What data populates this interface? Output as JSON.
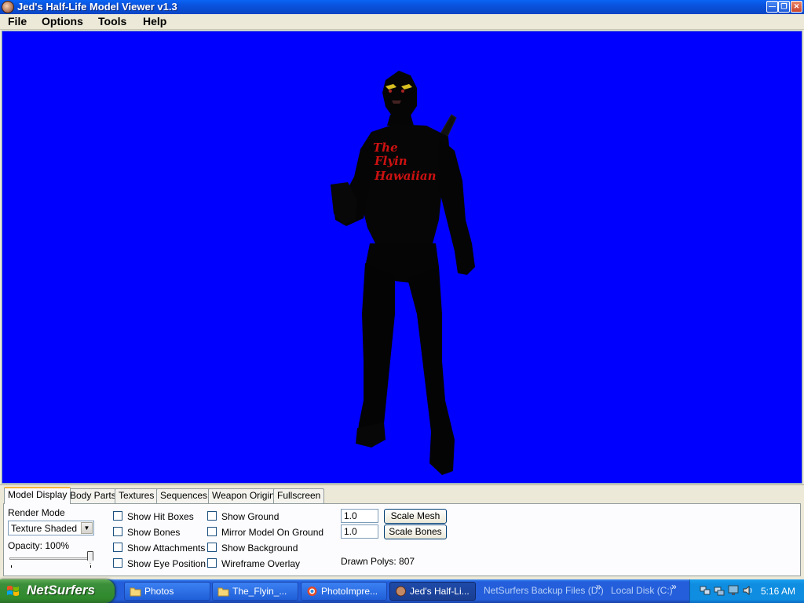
{
  "window": {
    "title": "Jed's Half-Life Model Viewer v1.3",
    "icon": "app-face-icon"
  },
  "menu": [
    "File",
    "Options",
    "Tools",
    "Help"
  ],
  "viewport": {
    "background": "#0000ff",
    "model_text": [
      "The",
      "Flyin",
      "Hawaiian"
    ],
    "model_text_color": "#cc1111"
  },
  "tabs": [
    "Model Display",
    "Body Parts",
    "Textures",
    "Sequences",
    "Weapon Origin",
    "Fullscreen"
  ],
  "active_tab": "Model Display",
  "render_mode": {
    "label": "Render Mode",
    "value": "Texture Shaded"
  },
  "opacity": {
    "label": "Opacity: 100%",
    "value_percent": 100
  },
  "checkboxes_col1": [
    "Show Hit Boxes",
    "Show Bones",
    "Show Attachments",
    "Show Eye Position"
  ],
  "checkboxes_col2": [
    "Show Ground",
    "Mirror Model On Ground",
    "Show Background",
    "Wireframe Overlay"
  ],
  "scale": {
    "mesh_value": "1.0",
    "mesh_button": "Scale Mesh",
    "bones_value": "1.0",
    "bones_button": "Scale Bones"
  },
  "drawn_polys": "Drawn Polys: 807",
  "taskbar": {
    "start_label": "NetSurfers",
    "tasks": [
      "Photos",
      "The_Flyin_...",
      "PhotoImpre...",
      "Jed's Half-Li..."
    ],
    "toolbars": [
      "NetSurfers Backup Files (D:)",
      "Local Disk (C:)"
    ],
    "chevron": "»",
    "clock": "5:16 AM"
  }
}
